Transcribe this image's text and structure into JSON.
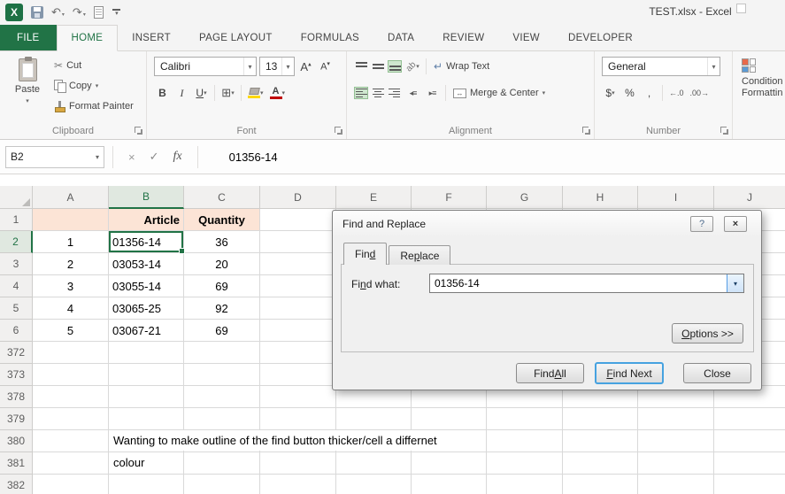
{
  "window": {
    "title": "TEST.xlsx - Excel"
  },
  "ribbon_tabs": [
    {
      "label": "FILE",
      "file": true
    },
    {
      "label": "HOME",
      "active": true
    },
    {
      "label": "INSERT"
    },
    {
      "label": "PAGE LAYOUT"
    },
    {
      "label": "FORMULAS"
    },
    {
      "label": "DATA"
    },
    {
      "label": "REVIEW"
    },
    {
      "label": "VIEW"
    },
    {
      "label": "DEVELOPER"
    }
  ],
  "ribbon": {
    "clipboard": {
      "label": "Clipboard",
      "paste": "Paste",
      "cut": "Cut",
      "copy": "Copy",
      "format_painter": "Format Painter"
    },
    "font": {
      "label": "Font",
      "name": "Calibri",
      "size": "13",
      "letter": "A",
      "bold": "B",
      "italic": "I",
      "underline": "U",
      "color_letter": "A"
    },
    "alignment": {
      "label": "Alignment",
      "wrap_text": "Wrap Text",
      "merge_center": "Merge & Center"
    },
    "number": {
      "label": "Number",
      "format": "General",
      "currency": "$",
      "percent": "%",
      "comma": ","
    },
    "conditional": {
      "line1": "Condition",
      "line2": "Formattin"
    }
  },
  "formula_bar": {
    "name_box": "B2",
    "fx_label": "fx",
    "value": "01356-14"
  },
  "sheet": {
    "columns": [
      "A",
      "B",
      "C",
      "D",
      "E",
      "F",
      "G",
      "H",
      "I",
      "J"
    ],
    "selected_column": "B",
    "selected_row": "2",
    "rows": [
      {
        "num": "1",
        "header_fill": true,
        "cells": {
          "A": "",
          "B": "Article",
          "C": "Quantity"
        }
      },
      {
        "num": "2",
        "selected": "B",
        "cells": {
          "A": "1",
          "B": "01356-14",
          "C": "36"
        }
      },
      {
        "num": "3",
        "cells": {
          "A": "2",
          "B": "03053-14",
          "C": "20"
        }
      },
      {
        "num": "4",
        "cells": {
          "A": "3",
          "B": "03055-14",
          "C": "69"
        }
      },
      {
        "num": "5",
        "cells": {
          "A": "4",
          "B": "03065-25",
          "C": "92"
        }
      },
      {
        "num": "6",
        "cells": {
          "A": "5",
          "B": "03067-21",
          "C": "69"
        }
      },
      {
        "num": "372"
      },
      {
        "num": "373"
      },
      {
        "num": "378"
      },
      {
        "num": "379"
      },
      {
        "num": "380",
        "overflow": "Wanting to make outline of the find button thicker/cell a differnet"
      },
      {
        "num": "381",
        "overflow": "colour"
      },
      {
        "num": "382"
      }
    ]
  },
  "dialog": {
    "title": "Find and Replace",
    "help_icon": "?",
    "close_icon": "×",
    "tabs": [
      {
        "label": "Find",
        "accel": "d",
        "active": true
      },
      {
        "label": "Replace",
        "accel": "p"
      }
    ],
    "find_what": {
      "label": "Find what:",
      "accel": "n",
      "value": "01356-14"
    },
    "options_button": {
      "label": "Options >>",
      "accel": "O"
    },
    "find_all": {
      "label": "Find All",
      "accel": "A"
    },
    "find_next": {
      "label": "Find Next",
      "accel": "F"
    },
    "close_button": {
      "label": "Close"
    }
  },
  "colors": {
    "excel_green": "#217346",
    "header_fill": "#fce4d6",
    "focus_blue": "#46a2e0"
  }
}
